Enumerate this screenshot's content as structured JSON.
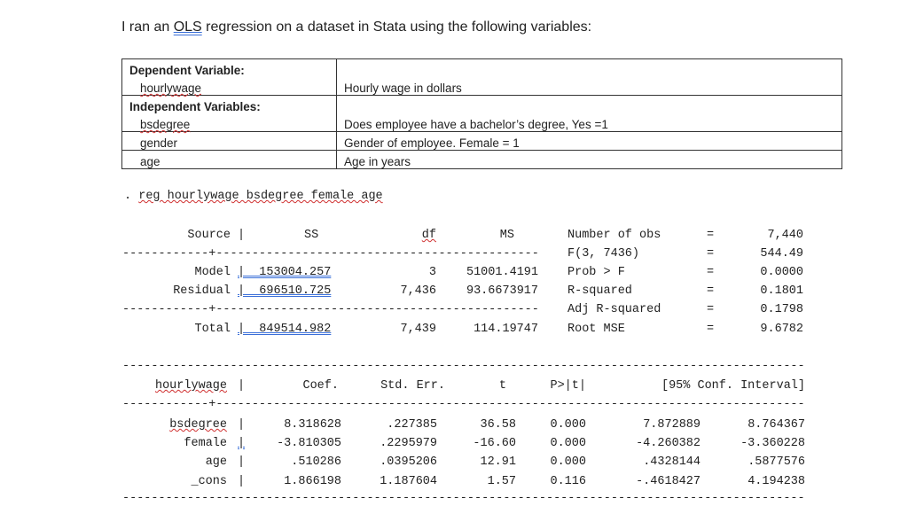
{
  "intro": {
    "before": "I ran an ",
    "ols": "OLS",
    "after": " regression on a dataset in Stata using the following variables:"
  },
  "vars": {
    "dep_label": "Dependent Variable:",
    "dep": {
      "name": "hourlywage",
      "desc": "Hourly wage in dollars"
    },
    "ind_label": "Independent Variables:",
    "ind": [
      {
        "name": "bsdegree",
        "desc": "Does employee have a bachelor’s degree, Yes =1"
      },
      {
        "name": "gender",
        "desc": "Gender of employee.  Female = 1"
      },
      {
        "name": "age",
        "desc": "Age in years"
      }
    ]
  },
  "command": {
    "dot": ".",
    "text": "reg hourlywage bsdegree female age"
  },
  "anova": {
    "headers": [
      "Source",
      "SS",
      "df",
      "MS"
    ],
    "rows": [
      {
        "source": "Model",
        "ss": "153004.257",
        "df": "3",
        "ms": "51001.4191"
      },
      {
        "source": "Residual",
        "ss": "696510.725",
        "df": "7,436",
        "ms": "93.6673917"
      },
      {
        "source": "Total",
        "ss": "849514.982",
        "df": "7,439",
        "ms": "114.19747"
      }
    ]
  },
  "stats": [
    {
      "label": "Number of obs",
      "value": "7,440"
    },
    {
      "label": "F(3, 7436)",
      "value": "544.49"
    },
    {
      "label": "Prob > F",
      "value": "0.0000"
    },
    {
      "label": "R-squared",
      "value": "0.1801"
    },
    {
      "label": "Adj R-squared",
      "value": "0.1798"
    },
    {
      "label": "Root MSE",
      "value": "9.6782"
    }
  ],
  "coef": {
    "headers": [
      "hourlywage",
      "Coef.",
      "Std. Err.",
      "t",
      "P>|t|",
      "[95% Conf. Interval]"
    ],
    "rows": [
      [
        "bsdegree",
        "8.318628",
        ".227385",
        "36.58",
        "0.000",
        "7.872889",
        "8.764367"
      ],
      [
        "female",
        "-3.810305",
        ".2295979",
        "-16.60",
        "0.000",
        "-4.260382",
        "-3.360228"
      ],
      [
        "age",
        ".510286",
        ".0395206",
        "12.91",
        "0.000",
        ".4328144",
        ".5877576"
      ],
      [
        "_cons",
        "1.866198",
        "1.187604",
        "1.57",
        "0.116",
        "-.4618427",
        "4.194238"
      ]
    ]
  }
}
